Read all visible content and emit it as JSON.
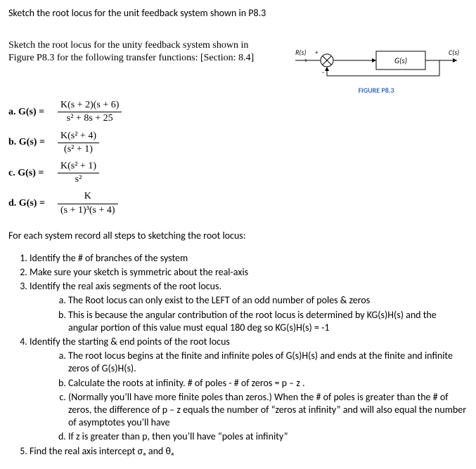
{
  "title": "Sketch the root locus for the unit feedback system shown in P8.3",
  "intro": "Sketch the root locus for the unity feedback system shown in Figure P8.3 for the following transfer functions: [Section: 8.4]",
  "figure": {
    "r_label": "R(s)",
    "g_label": "G(s)",
    "c_label": "C(s)",
    "caption": "FIGURE P8.3"
  },
  "tf": [
    {
      "label": "a.  G(s) =",
      "num": "K(s + 2)(s + 6)",
      "den": "s² + 8s + 25"
    },
    {
      "label": "b.  G(s) =",
      "num": "K(s² + 4)",
      "den": "(s² + 1)"
    },
    {
      "label": "c.  G(s) =",
      "num": "K(s² + 1)",
      "den": "s²"
    },
    {
      "label": "d.  G(s) =",
      "num": "K",
      "den": "(s + 1)³(s + 4)"
    }
  ],
  "lead": "For each system record all steps to sketching the root locus:",
  "steps": {
    "s1": "Identify the # of branches of the system",
    "s2": "Make sure your sketch is symmetric about the real-axis",
    "s3": "Identify the real axis segments of the root locus.",
    "s3a": "The Root locus can only exist to the LEFT of an odd number of poles & zeros",
    "s3b": "This is because the angular contribution of the root locus is determined by KG(s)H(s) and the angular portion of this value must equal 180 deg so KG(s)H(s) = -1",
    "s4": "Identify the starting & end points of the root locus",
    "s4a": "The root locus begins at the finite and infinite poles of G(s)H(s) and ends at the finite and infinite zeros of G(s)H(s).",
    "s4b": "Calculate the roots at infinity. # of poles - # of zeros = p – z .",
    "s4c": "(Normally you’ll have more finite poles than zeros.) When the # of poles is greater than the # of zeros, the difference of p – z equals the number of “zeros at infinity” and will also equal the number of asymptotes you’ll have",
    "s4d": "If z is greater than p, then you’ll have “poles at infinity”",
    "s5": "Find the real axis intercept σₐ and θₐ"
  }
}
